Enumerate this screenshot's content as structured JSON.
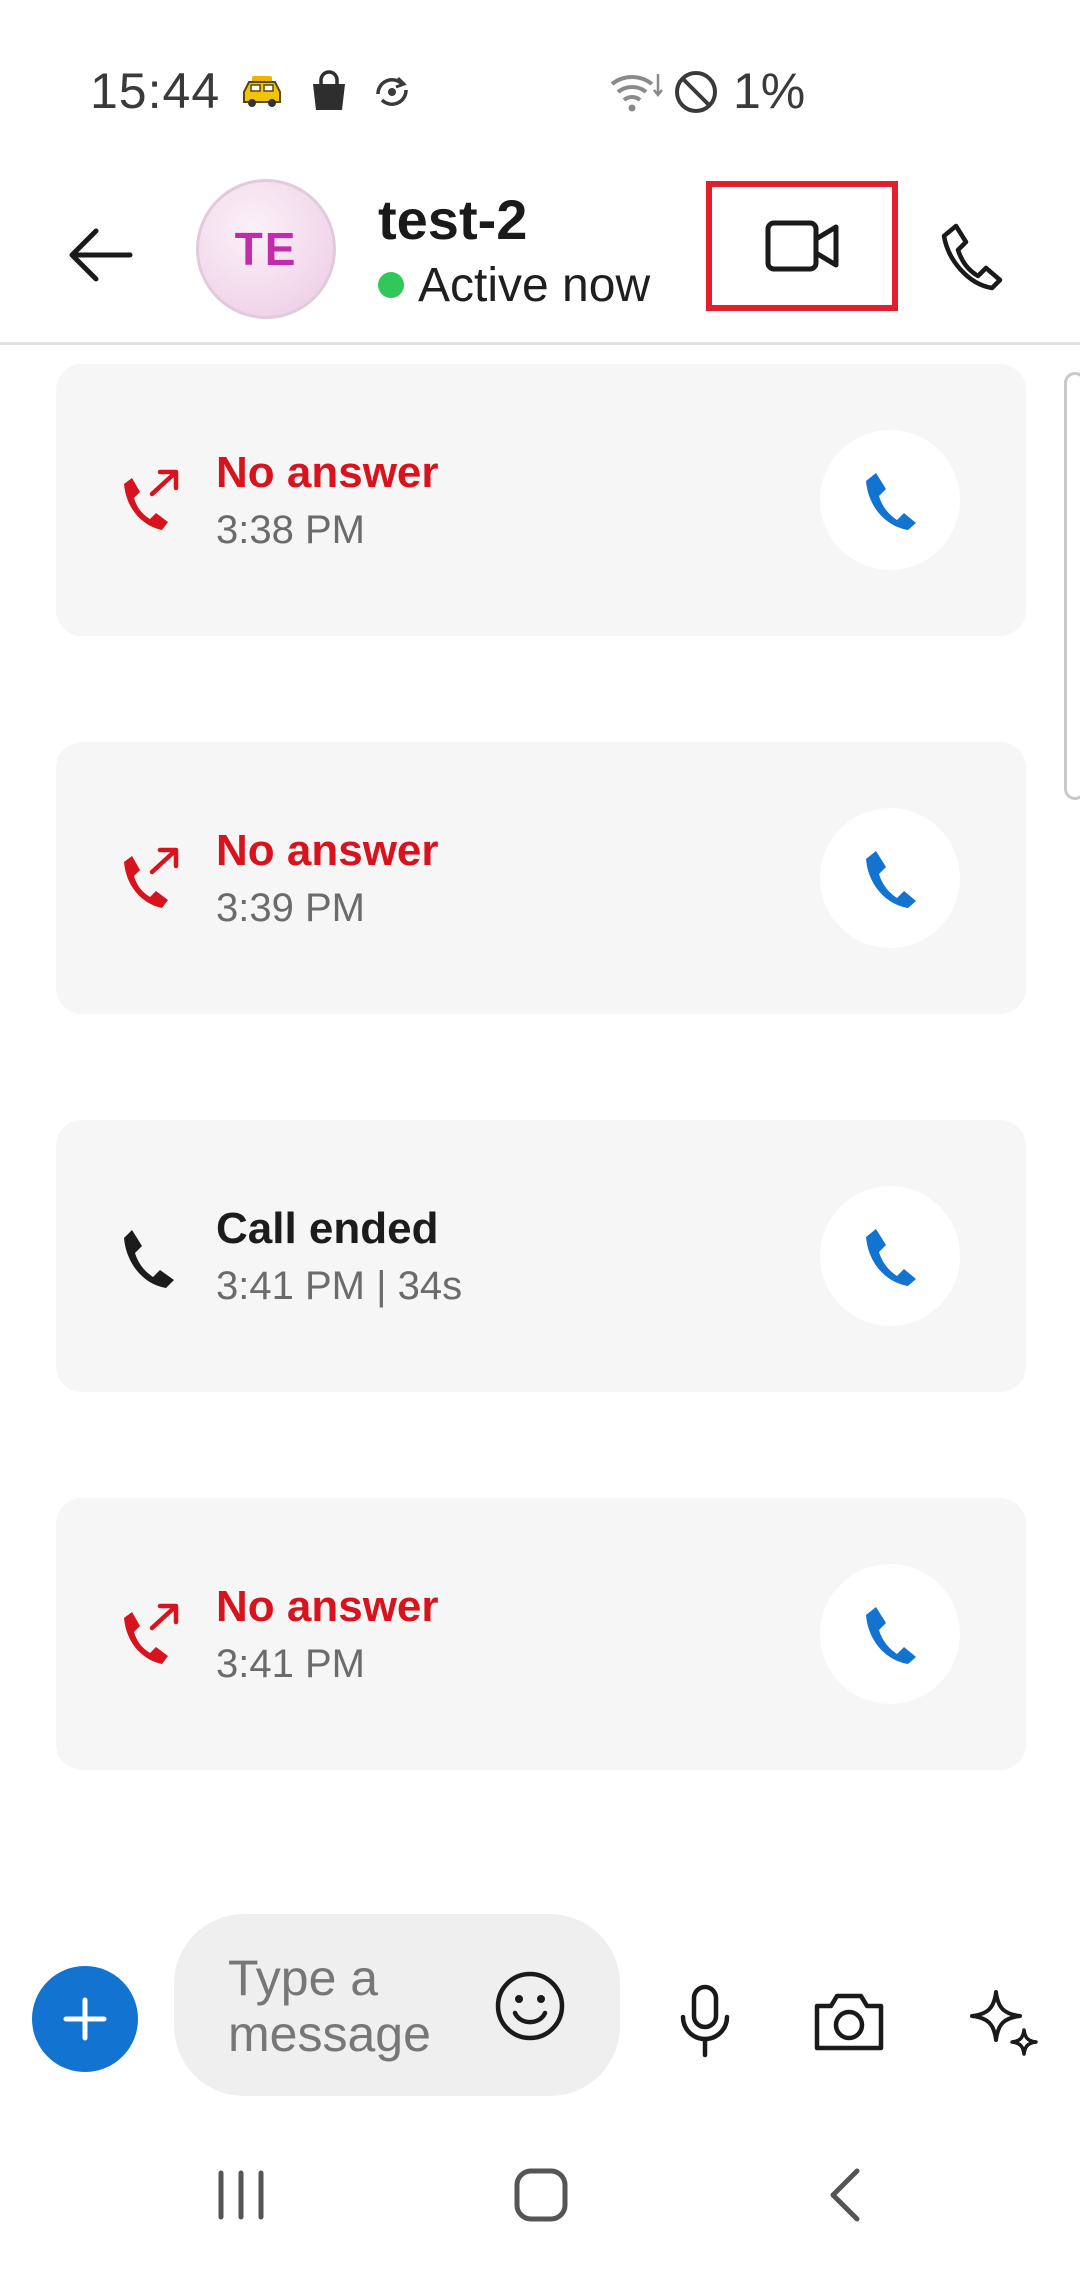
{
  "status_bar": {
    "time": "15:44",
    "battery": "1%",
    "icons": [
      "taxi-icon",
      "shopping-bag-icon",
      "sync-icon",
      "wifi-icon",
      "do-not-disturb-icon"
    ]
  },
  "header": {
    "avatar_initials": "TE",
    "name": "test-2",
    "status": "Active now"
  },
  "calls": [
    {
      "title": "No answer",
      "time": "3:38 PM",
      "type": "missed"
    },
    {
      "title": "No answer",
      "time": "3:39 PM",
      "type": "missed"
    },
    {
      "title": "Call ended",
      "time": "3:41 PM | 34s",
      "type": "ended"
    },
    {
      "title": "No answer",
      "time": "3:41 PM",
      "type": "missed"
    }
  ],
  "composer": {
    "placeholder": "Type a message"
  },
  "colors": {
    "accent_blue": "#1273d0",
    "missed_red": "#d7131d",
    "active_green": "#31c75a",
    "highlight_box": "#e0202e"
  }
}
